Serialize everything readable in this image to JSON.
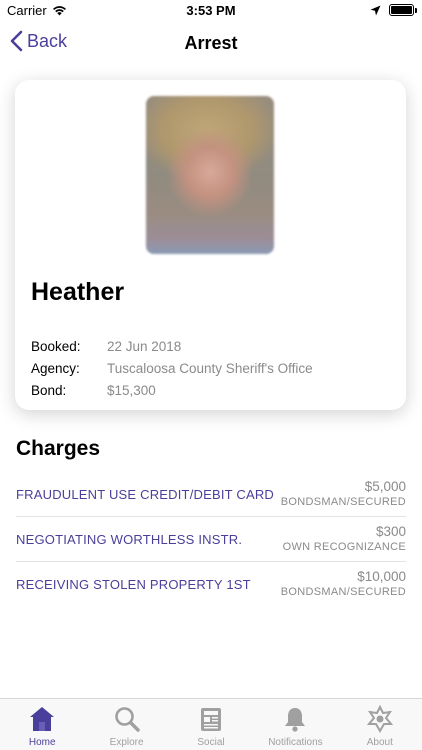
{
  "status_bar": {
    "carrier": "Carrier",
    "time": "3:53 PM"
  },
  "nav": {
    "back_label": "Back",
    "title": "Arrest"
  },
  "profile": {
    "name": "Heather",
    "booked_label": "Booked:",
    "booked_value": "22 Jun 2018",
    "agency_label": "Agency:",
    "agency_value": "Tuscaloosa County Sheriff's Office",
    "bond_label": "Bond:",
    "bond_value": "$15,300"
  },
  "charges": {
    "title": "Charges",
    "items": [
      {
        "name": "FRAUDULENT USE CREDIT/DEBIT CARD",
        "amount": "$5,000",
        "type": "BONDSMAN/SECURED"
      },
      {
        "name": "NEGOTIATING WORTHLESS INSTR.",
        "amount": "$300",
        "type": "OWN RECOGNIZANCE"
      },
      {
        "name": "RECEIVING STOLEN PROPERTY 1ST",
        "amount": "$10,000",
        "type": "BONDSMAN/SECURED"
      }
    ]
  },
  "tabs": [
    {
      "label": "Home",
      "icon": "home-icon",
      "active": true
    },
    {
      "label": "Explore",
      "icon": "search-icon",
      "active": false
    },
    {
      "label": "Social",
      "icon": "newspaper-icon",
      "active": false
    },
    {
      "label": "Notifications",
      "icon": "bell-icon",
      "active": false
    },
    {
      "label": "About",
      "icon": "sheriff-star-icon",
      "active": false
    }
  ],
  "colors": {
    "accent": "#4a3f9a",
    "muted": "#8a8a8a",
    "inactive_tab": "#a0a0a0"
  }
}
